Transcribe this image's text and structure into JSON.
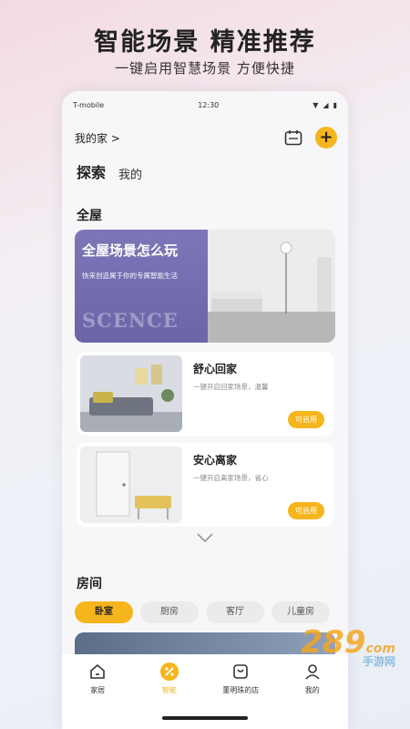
{
  "promo": {
    "headline": "智能场景 精准推荐",
    "subline": "一键启用智慧场景  方便快捷"
  },
  "status": {
    "carrier": "T-mobile",
    "time": "12:30"
  },
  "topbar": {
    "home_label": "我的家 >"
  },
  "tabs": [
    {
      "label": "探索",
      "active": true
    },
    {
      "label": "我的",
      "active": false
    }
  ],
  "whole_house": {
    "title": "全屋",
    "hero": {
      "title": "全屋场景怎么玩",
      "desc": "快来创造属于你的专属智能生活",
      "word": "SCENCE"
    }
  },
  "scenes": [
    {
      "name": "舒心回家",
      "desc": "一键开启回家场景，温馨",
      "button": "可启用"
    },
    {
      "name": "安心离家",
      "desc": "一键开启离家场景，省心",
      "button": "可启用"
    }
  ],
  "rooms": {
    "title": "房间",
    "chips": [
      {
        "label": "卧室",
        "active": true
      },
      {
        "label": "厨房",
        "active": false
      },
      {
        "label": "客厅",
        "active": false
      },
      {
        "label": "儿童房",
        "active": false
      }
    ]
  },
  "tabbar": [
    {
      "label": "家居",
      "icon": "home-icon",
      "active": false
    },
    {
      "label": "智能",
      "icon": "smart-icon",
      "active": true
    },
    {
      "label": "董明珠的店",
      "icon": "store-icon",
      "active": false
    },
    {
      "label": "我的",
      "icon": "profile-icon",
      "active": false
    }
  ],
  "watermark": {
    "brand": "289",
    "suffix": "com",
    "caption": "手游网"
  },
  "colors": {
    "accent": "#f5b51c",
    "hero_purple": "#7d77b8"
  }
}
